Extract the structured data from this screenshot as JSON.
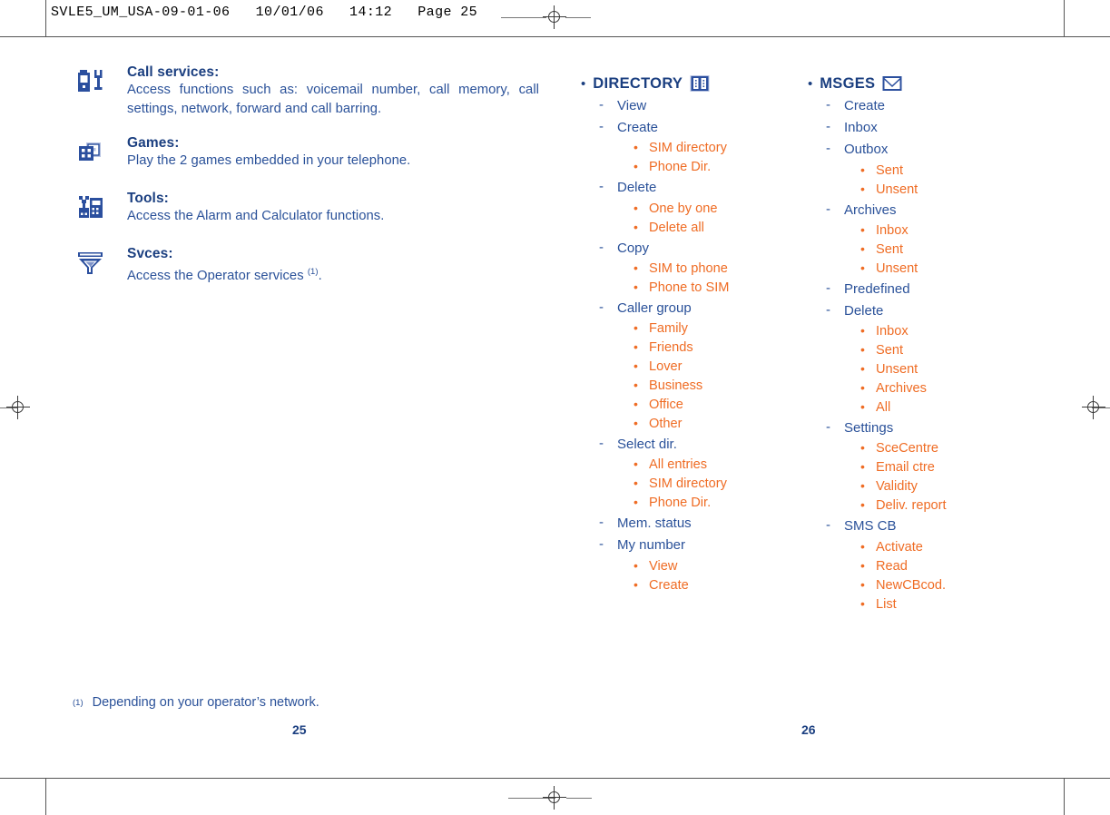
{
  "print_header": "SVLE5_UM_USA-09-01-06   10/01/06   14:12   Page 25",
  "colors": {
    "navy_heading": "#1b3f80",
    "navy_body": "#2a5199",
    "orange": "#ef6c24",
    "crop_mark": "#4a4a4a"
  },
  "left_column": {
    "features": [
      {
        "icon": "phone-tools-icon",
        "title": "Call services:",
        "body": "Access functions such as: voicemail number, call memory, call settings, network, forward and call barring."
      },
      {
        "icon": "dice-games-icon",
        "title": "Games:",
        "body": "Play the 2 games embedded in your telephone."
      },
      {
        "icon": "calculator-tools-icon",
        "title": "Tools:",
        "body": "Access the Alarm and Calculator functions."
      },
      {
        "icon": "services-funnel-icon",
        "title": "Svces:",
        "body_prefix": "Access the Operator services ",
        "body_footnote": "(1)",
        "body_suffix": "."
      }
    ]
  },
  "directory_column": {
    "heading": "DIRECTORY",
    "heading_icon": "directory-book-icon",
    "items": [
      {
        "label": "View",
        "children": []
      },
      {
        "label": "Create",
        "children": [
          "SIM directory",
          "Phone Dir."
        ]
      },
      {
        "label": "Delete",
        "children": [
          "One by one",
          "Delete all"
        ]
      },
      {
        "label": "Copy",
        "children": [
          "SIM to phone",
          "Phone to SIM"
        ]
      },
      {
        "label": "Caller group",
        "children": [
          "Family",
          "Friends",
          "Lover",
          "Business",
          "Office",
          "Other"
        ]
      },
      {
        "label": "Select dir.",
        "children": [
          "All entries",
          "SIM directory",
          "Phone Dir."
        ]
      },
      {
        "label": "Mem. status",
        "children": []
      },
      {
        "label": "My number",
        "children": [
          "View",
          "Create"
        ]
      }
    ]
  },
  "messages_column": {
    "heading": "MSGES",
    "heading_icon": "envelope-icon",
    "items": [
      {
        "label": "Create",
        "children": []
      },
      {
        "label": "Inbox",
        "children": []
      },
      {
        "label": "Outbox",
        "children": [
          "Sent",
          "Unsent"
        ]
      },
      {
        "label": "Archives",
        "children": [
          "Inbox",
          "Sent",
          "Unsent"
        ]
      },
      {
        "label": "Predefined",
        "children": []
      },
      {
        "label": "Delete",
        "children": [
          "Inbox",
          "Sent",
          "Unsent",
          "Archives",
          "All"
        ]
      },
      {
        "label": "Settings",
        "children": [
          "SceCentre",
          "Email ctre",
          "Validity",
          "Deliv. report"
        ]
      },
      {
        "label": "SMS CB",
        "children": [
          "Activate",
          "Read",
          "NewCBcod.",
          "List"
        ]
      }
    ]
  },
  "footnote": {
    "marker": "(1)",
    "text": "Depending on your operator’s network."
  },
  "folios": {
    "left": "25",
    "right": "26"
  }
}
